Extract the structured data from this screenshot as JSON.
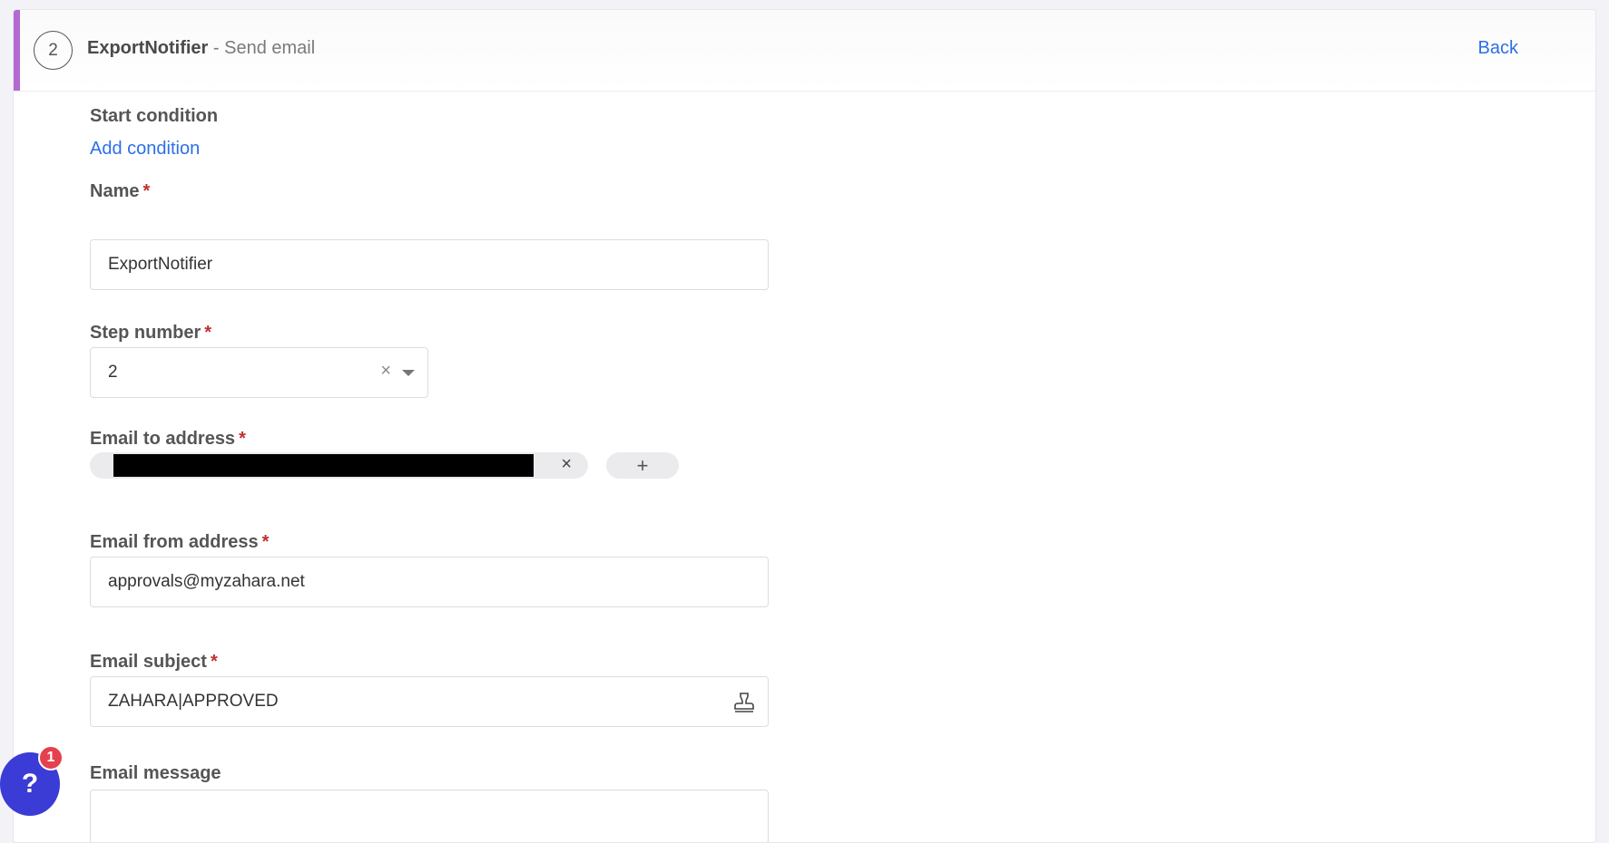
{
  "header": {
    "step_number": "2",
    "step_name": "ExportNotifier",
    "separator": " - ",
    "step_action": "Send email",
    "back_label": "Back"
  },
  "start_condition": {
    "label": "Start condition",
    "add_condition_label": "Add condition"
  },
  "form": {
    "name": {
      "label": "Name",
      "required_mark": "*",
      "value": "ExportNotifier"
    },
    "step_number": {
      "label": "Step number",
      "required_mark": "*",
      "value": "2",
      "clear_icon": "close-icon",
      "dropdown_icon": "caret-down-icon"
    },
    "email_to": {
      "label": "Email to address",
      "required_mark": "*",
      "chip_value": "[redacted]",
      "chip_remove_icon": "close-icon",
      "add_icon": "plus-icon",
      "remove_glyph": "×",
      "add_glyph": "+"
    },
    "email_from": {
      "label": "Email from address",
      "required_mark": "*",
      "value": "approvals@myzahara.net"
    },
    "email_subject": {
      "label": "Email subject",
      "required_mark": "*",
      "value": "ZAHARA|APPROVED",
      "suffix_icon": "stamp-icon"
    },
    "email_message": {
      "label": "Email message"
    }
  },
  "help_widget": {
    "icon": "question-icon",
    "glyph": "?",
    "badge_count": "1"
  },
  "colors": {
    "accent": "#b26ad1",
    "link": "#2c6fe6",
    "required": "#c0302d",
    "help": "#3b3bd6",
    "badge": "#e5404e"
  }
}
